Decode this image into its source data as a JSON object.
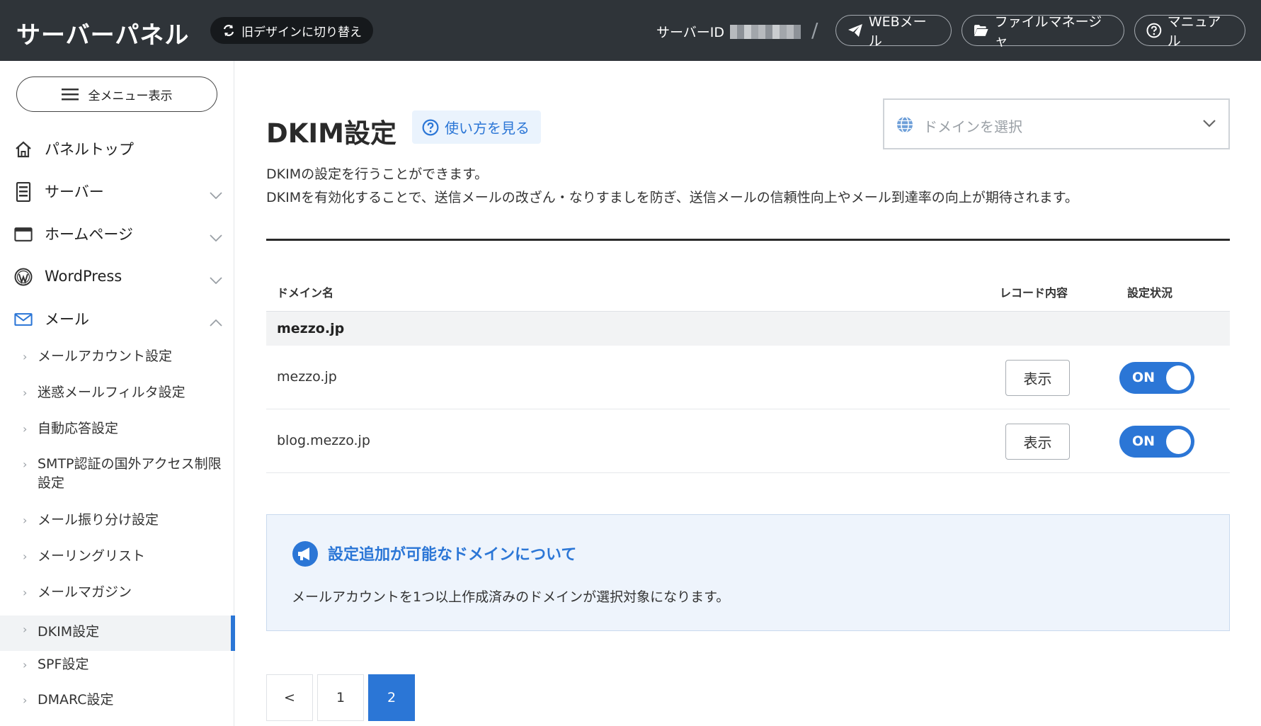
{
  "header": {
    "brand": "サーバーパネル",
    "old_design_label": "旧デザインに切り替え",
    "server_id_label": "サーバーID",
    "separator": "/",
    "webmail_label": "WEBメール",
    "filemanager_label": "ファイルマネージャ",
    "manual_label": "マニュアル"
  },
  "sidebar": {
    "all_menu_label": "全メニュー表示",
    "nav": [
      {
        "label": "パネルトップ",
        "icon": "home-icon"
      },
      {
        "label": "サーバー",
        "icon": "server-icon"
      },
      {
        "label": "ホームページ",
        "icon": "browser-window-icon"
      },
      {
        "label": "WordPress",
        "icon": "wordpress-icon"
      },
      {
        "label": "メール",
        "icon": "mail-icon"
      }
    ],
    "mail_sub": [
      {
        "label": "メールアカウント設定"
      },
      {
        "label": "迷惑メールフィルタ設定"
      },
      {
        "label": "自動応答設定"
      },
      {
        "label": "SMTP認証の国外アクセス制限設定"
      },
      {
        "label": "メール振り分け設定"
      },
      {
        "label": "メーリングリスト"
      },
      {
        "label": "メールマガジン"
      },
      {
        "label": "DKIM設定"
      },
      {
        "label": "SPF設定"
      },
      {
        "label": "DMARC設定"
      }
    ],
    "active_item": "DKIM設定"
  },
  "main": {
    "title": "DKIM設定",
    "howto_label": "使い方を見る",
    "domain_select_placeholder": "ドメインを選択",
    "description_line1": "DKIMの設定を行うことができます。",
    "description_line2": "DKIMを有効化することで、送信メールの改ざん・なりすましを防ぎ、送信メールの信頼性向上やメール到達率の向上が期待されます。",
    "table": {
      "headers": {
        "domain": "ドメイン名",
        "record": "レコード内容",
        "status": "設定状況"
      },
      "group": "mezzo.jp",
      "rows": [
        {
          "domain": "mezzo.jp",
          "button": "表示",
          "status": "ON"
        },
        {
          "domain": "blog.mezzo.jp",
          "button": "表示",
          "status": "ON"
        }
      ]
    },
    "notice": {
      "title": "設定追加が可能なドメインについて",
      "text": "メールアカウントを1つ以上作成済みのドメインが選択対象になります。"
    },
    "pagination": {
      "prev": "<",
      "pages": [
        "1",
        "2"
      ],
      "current": "2"
    }
  },
  "colors": {
    "accent": "#2b76d6",
    "header_bg": "#2f3439"
  }
}
